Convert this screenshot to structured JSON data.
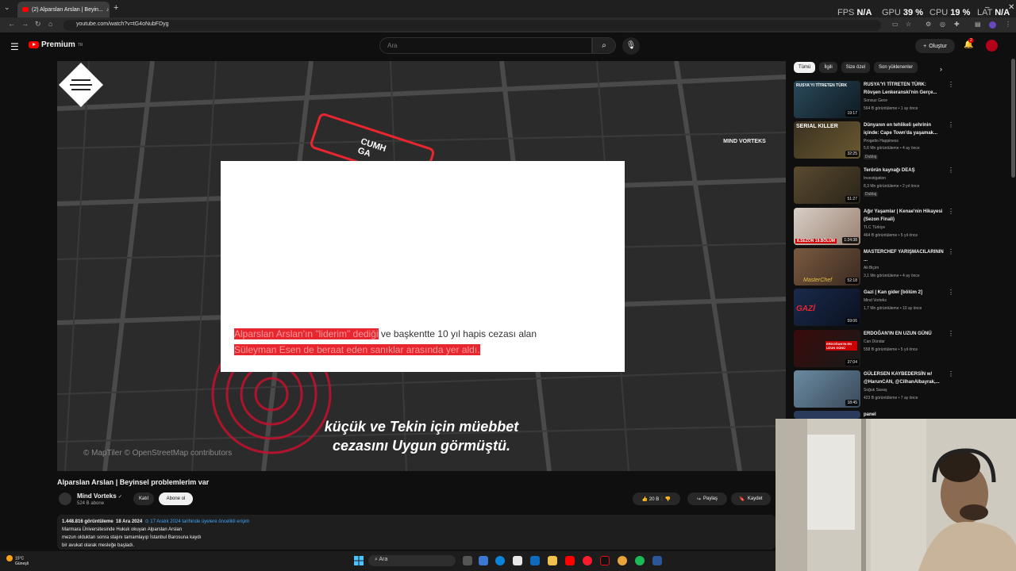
{
  "browser": {
    "tab_title": "(2) Alparslan Arslan | Beyin...",
    "url": "youtube.com/watch?v=tG4oNubFDyg",
    "new_tab": "+"
  },
  "overlay": {
    "fps_label": "FPS",
    "fps_value": "N/A",
    "gpu_label": "GPU",
    "gpu_value": "39 %",
    "cpu_label": "CPU",
    "cpu_value": "19 %",
    "lat_label": "LAT",
    "lat_value": "N/A"
  },
  "youtube": {
    "logo_text": "Premium",
    "logo_sup": "TR",
    "search_placeholder": "Ara",
    "create_label": "Oluştur",
    "notif_count": "2"
  },
  "video": {
    "highlight_line1_red": "Alparslan Arslan'ın \"liderim\" dediği",
    "highlight_line1_rest": " ve başkentte 10 yıl hapis cezası alan",
    "highlight_line2_red": "Süleyman Esen de beraat eden sanıklar arasında yer aldı.",
    "caption_line1": "küçük ve Tekin için müebbet",
    "caption_line2": "cezasını Uygun görmüştü.",
    "map_credit": "© MapTiler © OpenStreetMap contributors",
    "map_label": "CUMH",
    "map_label2": "GA",
    "watermark": "MIND VORTEKS"
  },
  "details": {
    "title": "Alparslan Arslan | Beyinsel problemlerim var",
    "channel": "Mind Vorteks",
    "subscribers": "524 B abone",
    "join": "Katıl",
    "subscribe": "Abone ol",
    "likes": "20 B",
    "share": "Paylaş",
    "save": "Kaydet",
    "views": "1.448.816 görüntüleme",
    "date": "18 Ara 2024",
    "early_access": "17 Aralık 2024 tarihinde üyelere öncelikli erişim",
    "desc_line1": "Marmara Üniversitesinde Hukuk okuyan Alparslan Arslan",
    "desc_line2": "mezun olduktan sonra stajını tamamlayıp İstanbul Barosuna kaydı",
    "desc_line3": "bir avukat olarak mesleğe başladı."
  },
  "chips": [
    "Tümü",
    "İlgili",
    "Size özel",
    "Son yüklenenler"
  ],
  "recommendations": [
    {
      "title": "RUSYA'YI TİTRETEN TÜRK: Rövşen Lenkeranski'nin Gerçe...",
      "channel": "Sonsuz Gece",
      "meta": "564 B görüntüleme • 1 ay önce",
      "duration": "19:17",
      "thumb_text": "RUSYA'YI TİTRETEN TÜRK",
      "dubbed": ""
    },
    {
      "title": "Dünyanın en tehlikeli şehrinin içinde: Cape Town'da yaşamak...",
      "channel": "Progetto Happiness",
      "meta": "5,6 Mn görüntüleme • 4 ay önce",
      "duration": "32:25",
      "thumb_text": "SERIAL KILLER",
      "dubbed": "Dublaj"
    },
    {
      "title": "Terörün kaynağı DEAŞ",
      "channel": "Investigation",
      "meta": "8,3 Mn görüntüleme • 2 yıl önce",
      "duration": "51:27",
      "thumb_text": "",
      "dubbed": "Dublaj"
    },
    {
      "title": "Ağır Yaşamlar | Kenae'nin Hikayesi (Sezon Finali)",
      "channel": "TLC Türkiye",
      "meta": "464 B görüntüleme • 5 yıl önce",
      "duration": "1:24:38",
      "thumb_text": "8.SEZON 19.BÖLÜM",
      "dubbed": ""
    },
    {
      "title": "MASTERCHEF YARIŞMACILARININ ...",
      "channel": "Ali Biçim",
      "meta": "3,1 Mn görüntüleme • 4 ay önce",
      "duration": "52:18",
      "thumb_text": "MasterChef",
      "dubbed": ""
    },
    {
      "title": "Gazi | Kan gider [bölüm 2]",
      "channel": "Mind Vorteks",
      "meta": "1,7 Mn görüntüleme • 10 ay önce",
      "duration": "59:06",
      "thumb_text": "GAZİ",
      "dubbed": ""
    },
    {
      "title": "ERDOĞAN'IN EN UZUN GÜNÜ",
      "channel": "Can Dündar",
      "meta": "558 B görüntüleme • 5 yıl önce",
      "duration": "37:04",
      "thumb_text": "ERDOĞAN'IN EN UZUN GÜNÜ",
      "dubbed": ""
    },
    {
      "title": "GÜLERSEN KAYBEDERSİN w/ @HarunCAN, @CilhanAlbayrak,...",
      "channel": "Soğuk Savaş",
      "meta": "423 B görüntüleme • 7 ay önce",
      "duration": "18:45",
      "thumb_text": "",
      "dubbed": ""
    },
    {
      "title": "panel",
      "channel": "",
      "meta": "",
      "duration": "",
      "thumb_text": "",
      "dubbed": ""
    }
  ],
  "taskbar": {
    "temp": "15°C",
    "weather": "Güneşli",
    "search": "Ara"
  },
  "colors": {
    "brand": "#ff0000",
    "highlight": "#e8262f",
    "link": "#3ea6ff"
  }
}
